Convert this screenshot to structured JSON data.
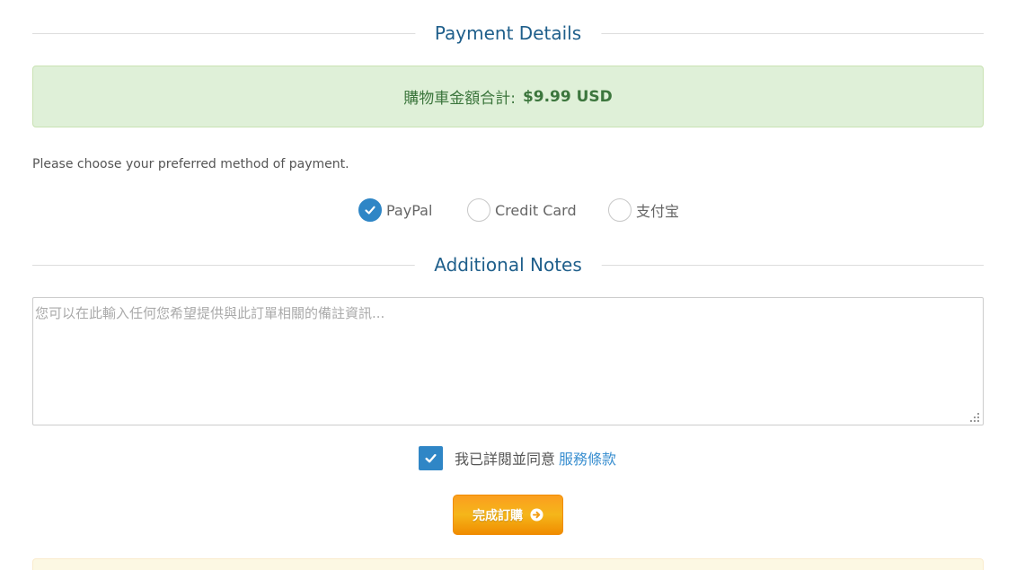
{
  "payment_section": {
    "title": "Payment Details",
    "total_label": "購物車金額合計:",
    "total_amount": "$9.99 USD",
    "choose_text": "Please choose your preferred method of payment.",
    "methods": [
      {
        "label": "PayPal",
        "selected": true
      },
      {
        "label": "Credit Card",
        "selected": false
      },
      {
        "label": "支付宝",
        "selected": false
      }
    ]
  },
  "notes_section": {
    "title": "Additional Notes",
    "placeholder": "您可以在此輸入任何您希望提供與此訂單相關的備註資訊...",
    "value": ""
  },
  "agreement": {
    "checked": true,
    "text": "我已詳閱並同意",
    "link_text": "服務條款"
  },
  "submit": {
    "label": "完成訂購",
    "icon": "arrow-circle-right-icon"
  },
  "colors": {
    "accent": "#2f86c6",
    "heading": "#1f5f8b",
    "success_bg": "#dff0d8",
    "success_text": "#3c763d",
    "button_orange": "#f5a31a",
    "warning_bg": "#fcf8e3"
  }
}
